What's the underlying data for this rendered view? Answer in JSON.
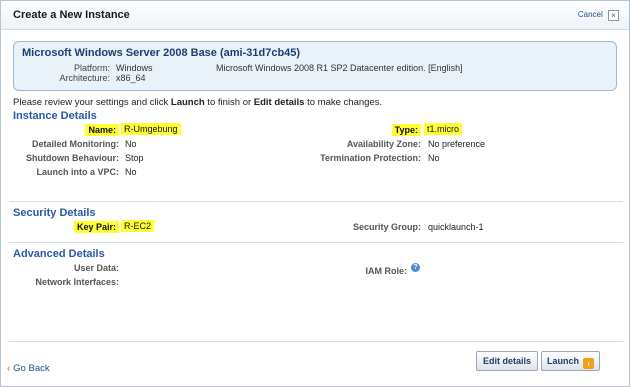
{
  "window": {
    "title": "Create a New Instance",
    "cancel_label": "Cancel",
    "close_glyph": "×"
  },
  "ami": {
    "title": "Microsoft Windows Server 2008 Base (ami-31d7cb45)",
    "platform_label": "Platform:",
    "platform_value": "Windows",
    "architecture_label": "Architecture:",
    "architecture_value": "x86_64",
    "description": "Microsoft Windows 2008 R1 SP2 Datacenter edition. [English]"
  },
  "intro": {
    "prefix": "Please review your settings and click ",
    "launch_word": "Launch",
    "middle": " to finish or ",
    "edit_word": "Edit details",
    "suffix": " to make changes."
  },
  "instance_details": {
    "title": "Instance Details",
    "name_label": "Name:",
    "name_value": "R-Umgebung",
    "type_label": "Type:",
    "type_value": "t1.micro",
    "monitoring_label": "Detailed Monitoring:",
    "monitoring_value": "No",
    "az_label": "Availability Zone:",
    "az_value": "No preference",
    "shutdown_label": "Shutdown Behaviour:",
    "shutdown_value": "Stop",
    "termination_label": "Termination Protection:",
    "termination_value": "No",
    "vpc_label": "Launch into a VPC:",
    "vpc_value": "No"
  },
  "security_details": {
    "title": "Security Details",
    "keypair_label": "Key Pair:",
    "keypair_value": "R-EC2",
    "group_label": "Security Group:",
    "group_value": "quicklaunch-1"
  },
  "advanced_details": {
    "title": "Advanced Details",
    "userdata_label": "User Data:",
    "network_label": "Network Interfaces:",
    "iam_label": "IAM Role:"
  },
  "footer": {
    "goback_label": "Go Back",
    "edit_button": "Edit details",
    "launch_button": "Launch"
  },
  "colors": {
    "highlight": "#ffff33",
    "section_title": "#2a5aa3",
    "launch_arrow": "#f2a01c"
  }
}
